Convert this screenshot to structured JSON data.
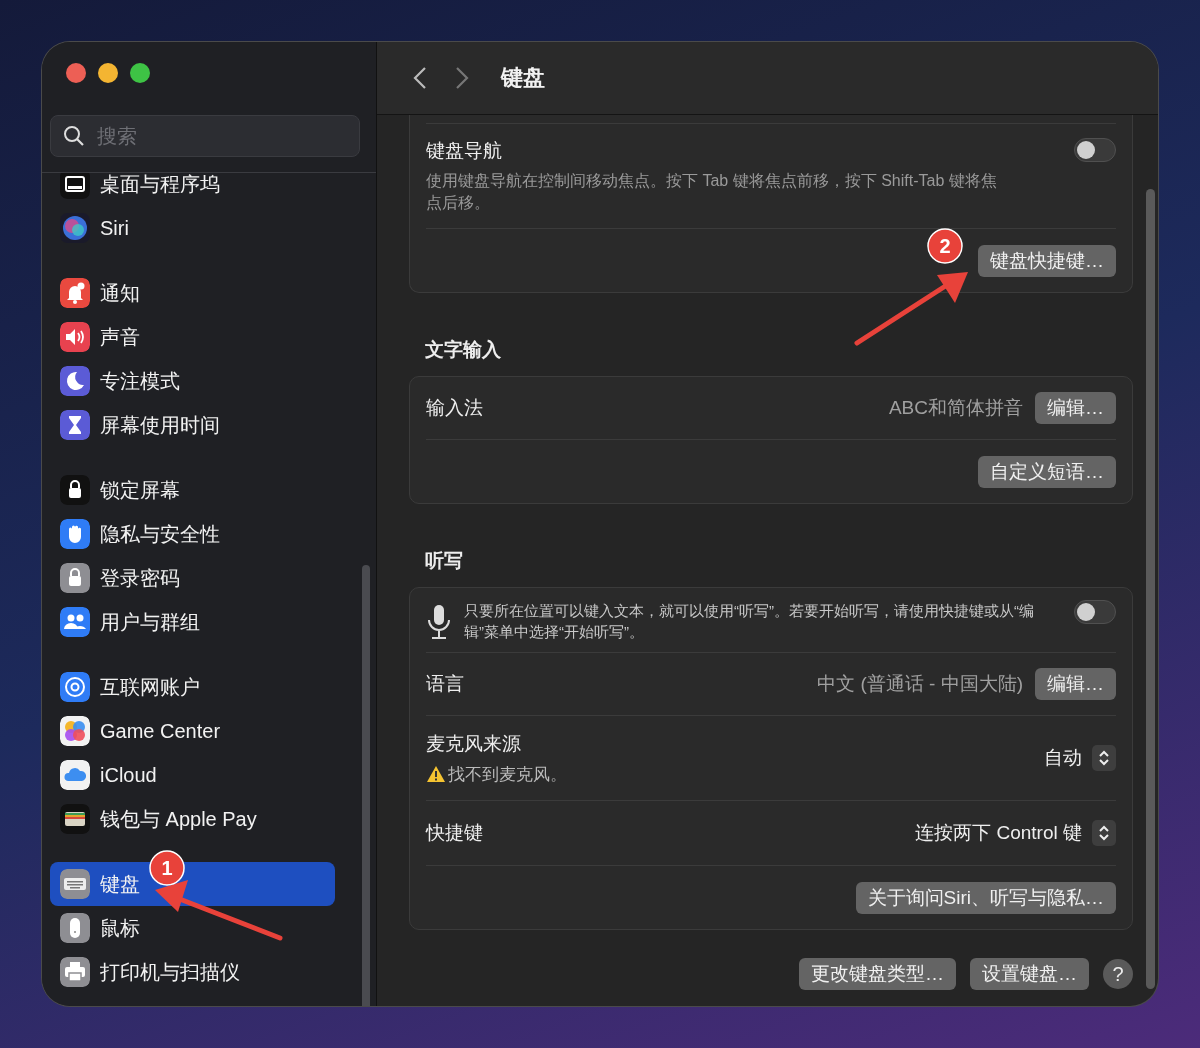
{
  "window": {
    "title": "键盘"
  },
  "sidebar": {
    "search": {
      "placeholder": "搜索"
    },
    "groups": [
      {
        "items": [
          {
            "kind": "dock",
            "label": "桌面与程序坞",
            "selected": false
          },
          {
            "kind": "siri",
            "label": "Siri",
            "selected": false
          }
        ]
      },
      {
        "items": [
          {
            "kind": "notifications",
            "label": "通知",
            "selected": false
          },
          {
            "kind": "sound",
            "label": "声音",
            "selected": false
          },
          {
            "kind": "focus",
            "label": "专注模式",
            "selected": false
          },
          {
            "kind": "screentime",
            "label": "屏幕使用时间",
            "selected": false
          }
        ]
      },
      {
        "items": [
          {
            "kind": "lockscreen",
            "label": "锁定屏幕",
            "selected": false
          },
          {
            "kind": "privacy",
            "label": "隐私与安全性",
            "selected": false
          },
          {
            "kind": "password",
            "label": "登录密码",
            "selected": false
          },
          {
            "kind": "users",
            "label": "用户与群组",
            "selected": false
          }
        ]
      },
      {
        "items": [
          {
            "kind": "internet",
            "label": "互联网账户",
            "selected": false
          },
          {
            "kind": "gamecenter",
            "label": "Game Center",
            "selected": false
          },
          {
            "kind": "icloud",
            "label": "iCloud",
            "selected": false
          },
          {
            "kind": "wallet",
            "label": "钱包与 Apple Pay",
            "selected": false
          }
        ]
      },
      {
        "items": [
          {
            "kind": "keyboard",
            "label": "键盘",
            "selected": true
          },
          {
            "kind": "mouse",
            "label": "鼠标",
            "selected": false
          },
          {
            "kind": "printer",
            "label": "打印机与扫描仪",
            "selected": false
          }
        ]
      }
    ]
  },
  "sections": [
    {
      "rows": [
        {
          "kind": "toggle",
          "label": "键盘导航",
          "description": "使用键盘导航在控制间移动焦点。按下 Tab 键将焦点前移，按下 Shift-Tab 键将焦点后移。",
          "on": false
        },
        {
          "kind": "button",
          "button": "键盘快捷键…"
        }
      ]
    },
    {
      "title": "文字输入",
      "rows": [
        {
          "kind": "value-button",
          "label": "输入法",
          "value": "ABC和简体拼音",
          "button": "编辑…"
        },
        {
          "kind": "button",
          "button": "自定义短语…"
        }
      ]
    },
    {
      "title": "听写",
      "rows": [
        {
          "kind": "mic-toggle",
          "description": "只要所在位置可以键入文本，就可以使用“听写”。若要开始听写，请使用快捷键或从“编辑”菜单中选择“开始听写”。",
          "on": false
        },
        {
          "kind": "value-button",
          "label": "语言",
          "value": "中文 (普通话 - 中国大陆)",
          "button": "编辑…"
        },
        {
          "kind": "popup",
          "label": "麦克风来源",
          "warning": "找不到麦克风。",
          "value": "自动"
        },
        {
          "kind": "popup",
          "label": "快捷键",
          "value": "连按两下 Control 键"
        },
        {
          "kind": "button",
          "button": "关于询问Siri、听写与隐私…"
        }
      ]
    }
  ],
  "footer_buttons": [
    "更改键盘类型…",
    "设置键盘…"
  ],
  "help": "?",
  "annotations": [
    {
      "label": "1"
    },
    {
      "label": "2"
    }
  ]
}
